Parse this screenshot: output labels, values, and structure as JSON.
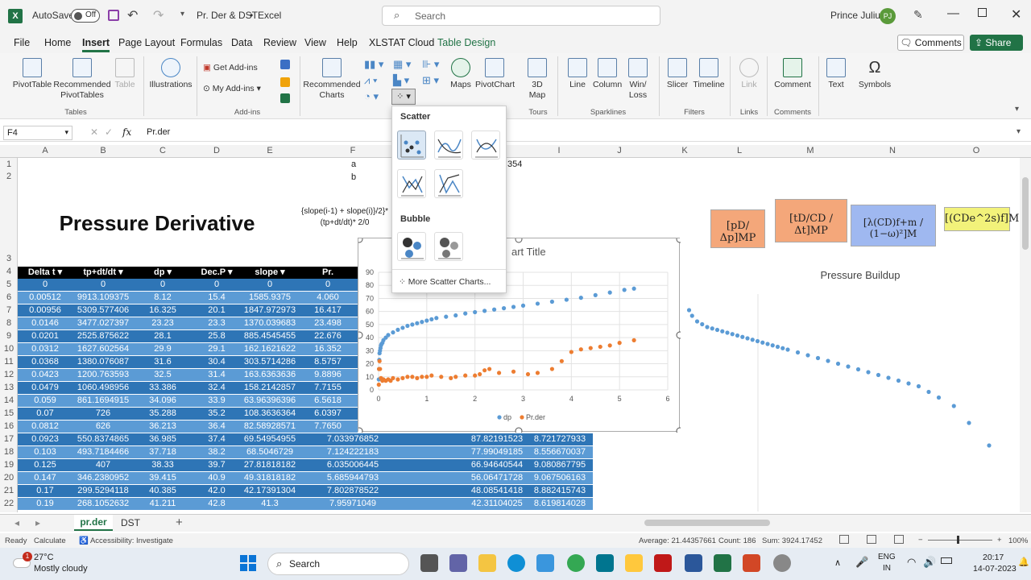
{
  "titlebar": {
    "autosave_label": "AutoSave",
    "autosave_state": "Off",
    "doc_title": "Pr. Der & DST",
    "sep": "•",
    "app_name": "Excel",
    "search_placeholder": "Search",
    "user_name": "Prince Julius",
    "user_initials": "PJ"
  },
  "menu": {
    "items": [
      "File",
      "Home",
      "Insert",
      "Page Layout",
      "Formulas",
      "Data",
      "Review",
      "View",
      "Help",
      "XLSTAT Cloud",
      "Table Design"
    ],
    "comments_label": "Comments",
    "share_label": "Share"
  },
  "ribbon": {
    "pivot": "PivotTable",
    "rec_pivot": "Recommended PivotTables",
    "table": "Table",
    "illustrations": "Illustrations",
    "get_addins": "Get Add-ins",
    "my_addins": "My Add-ins",
    "rec_charts": "Recommended Charts",
    "maps": "Maps",
    "pivotchart": "PivotChart",
    "map3d": "3D Map",
    "line": "Line",
    "column": "Column",
    "winloss": "Win/ Loss",
    "slicer": "Slicer",
    "timeline": "Timeline",
    "link": "Link",
    "comment": "Comment",
    "text": "Text",
    "symbols": "Symbols",
    "groups": [
      "Tables",
      "Add-ins",
      "Tours",
      "Sparklines",
      "Filters",
      "Links",
      "Comments"
    ]
  },
  "formula_bar": {
    "name_box": "F4",
    "fx": "fx",
    "content": "Pr.der"
  },
  "columns": [
    "A",
    "B",
    "C",
    "D",
    "E",
    "F",
    "G",
    "H",
    "I",
    "J",
    "K",
    "L",
    "M",
    "N",
    "O"
  ],
  "rows": [
    "1",
    "2",
    "3",
    "4",
    "5",
    "6",
    "7",
    "8",
    "9",
    "10",
    "11",
    "12",
    "13",
    "14",
    "15",
    "16",
    "17",
    "18",
    "19",
    "20",
    "21",
    "22"
  ],
  "sheet": {
    "row1_f": "a",
    "row2_f": "b",
    "h1_value": "354",
    "title": "Pressure Derivative",
    "formula_note": "{slope(i-1) + slope(i)}/2}*(tp+dt/dt)* 2/0",
    "headers": [
      "Delta t",
      "tp+dt/dt",
      "dp",
      "Dec.P",
      "slope",
      "Pr."
    ],
    "rows": [
      [
        "0",
        "0",
        "0",
        "0",
        "0",
        "0",
        "",
        ""
      ],
      [
        "0.00512",
        "9913.109375",
        "8.12",
        "15.4",
        "1585.9375",
        "4.060",
        "",
        ""
      ],
      [
        "0.00956",
        "5309.577406",
        "16.325",
        "20.1",
        "1847.972973",
        "16.417",
        "",
        ""
      ],
      [
        "0.0146",
        "3477.027397",
        "23.23",
        "23.3",
        "1370.039683",
        "23.498",
        "",
        ""
      ],
      [
        "0.0201",
        "2525.875622",
        "28.1",
        "25.8",
        "885.4545455",
        "22.676",
        "",
        ""
      ],
      [
        "0.0312",
        "1627.602564",
        "29.9",
        "29.1",
        "162.1621622",
        "16.352",
        "",
        ""
      ],
      [
        "0.0368",
        "1380.076087",
        "31.6",
        "30.4",
        "303.5714286",
        "8.5757",
        "",
        ""
      ],
      [
        "0.0423",
        "1200.763593",
        "32.5",
        "31.4",
        "163.6363636",
        "9.8896",
        "",
        ""
      ],
      [
        "0.0479",
        "1060.498956",
        "33.386",
        "32.4",
        "158.2142857",
        "7.7155",
        "",
        ""
      ],
      [
        "0.059",
        "861.1694915",
        "34.096",
        "33.9",
        "63.96396396",
        "6.5618",
        "",
        ""
      ],
      [
        "0.07",
        "726",
        "35.288",
        "35.2",
        "108.3636364",
        "6.0397",
        "",
        ""
      ],
      [
        "0.0812",
        "626",
        "36.213",
        "36.4",
        "82.58928571",
        "7.7650",
        "",
        ""
      ],
      [
        "0.0923",
        "550.8374865",
        "36.985",
        "37.4",
        "69.54954955",
        "7.033976852",
        "87.82191523",
        "8.721727933"
      ],
      [
        "0.103",
        "493.7184466",
        "37.718",
        "38.2",
        "68.5046729",
        "7.124222183",
        "77.99049185",
        "8.556670037"
      ],
      [
        "0.125",
        "407",
        "38.33",
        "39.7",
        "27.81818182",
        "6.035006445",
        "66.94640544",
        "9.080867795"
      ],
      [
        "0.147",
        "346.2380952",
        "39.415",
        "40.9",
        "49.31818182",
        "5.685944793",
        "56.06471728",
        "9.067506163"
      ],
      [
        "0.17",
        "299.5294118",
        "40.385",
        "42.0",
        "42.17391304",
        "7.802878522",
        "48.08541418",
        "8.882415743"
      ],
      [
        "0.19",
        "268.1052632",
        "41.211",
        "42.8",
        "41.3",
        "7.95971049",
        "42.31104025",
        "8.619814028"
      ]
    ]
  },
  "formulas": {
    "f1": "[pD/Δp]MP",
    "f2": "[tD/CD / Δt]MP",
    "f3": "[λ(CD)f+m / (1−ω)²]M",
    "f4": "[(CDe^2s)f]M"
  },
  "dropdown": {
    "scatter_label": "Scatter",
    "bubble_label": "Bubble",
    "more_label": "More Scatter Charts..."
  },
  "chart_data": [
    {
      "type": "scatter",
      "title": "Chart Title",
      "visible_title": "art Title",
      "x_ticks": [
        "0",
        "1",
        "2",
        "3",
        "4",
        "5",
        "6"
      ],
      "y_ticks": [
        "0",
        "10",
        "20",
        "30",
        "40",
        "50",
        "60",
        "70",
        "80",
        "90"
      ],
      "xlim": [
        0,
        6
      ],
      "ylim": [
        0,
        90
      ],
      "legend": "bottom",
      "grid": true,
      "series": [
        {
          "name": "dp",
          "color": "#5b9bd5",
          "points": [
            [
              0.005,
              8
            ],
            [
              0.01,
              16
            ],
            [
              0.015,
              23
            ],
            [
              0.02,
              28
            ],
            [
              0.03,
              30
            ],
            [
              0.04,
              32
            ],
            [
              0.05,
              34
            ],
            [
              0.06,
              35
            ],
            [
              0.08,
              36
            ],
            [
              0.1,
              38
            ],
            [
              0.15,
              40
            ],
            [
              0.2,
              42
            ],
            [
              0.3,
              44
            ],
            [
              0.4,
              46
            ],
            [
              0.5,
              47.5
            ],
            [
              0.6,
              49
            ],
            [
              0.7,
              50
            ],
            [
              0.8,
              51
            ],
            [
              0.9,
              52
            ],
            [
              1.0,
              53
            ],
            [
              1.1,
              54
            ],
            [
              1.2,
              55
            ],
            [
              1.4,
              56
            ],
            [
              1.6,
              57
            ],
            [
              1.8,
              58.5
            ],
            [
              2.0,
              59.5
            ],
            [
              2.2,
              60.5
            ],
            [
              2.4,
              61.5
            ],
            [
              2.6,
              62.5
            ],
            [
              2.8,
              63.5
            ],
            [
              3.0,
              64.5
            ],
            [
              3.3,
              66
            ],
            [
              3.6,
              67.5
            ],
            [
              3.9,
              69
            ],
            [
              4.2,
              70.5
            ],
            [
              4.5,
              72.5
            ],
            [
              4.8,
              74.5
            ],
            [
              5.1,
              76.5
            ],
            [
              5.3,
              77.5
            ]
          ]
        },
        {
          "name": "Pr.der",
          "color": "#ed7d31",
          "points": [
            [
              0.005,
              4
            ],
            [
              0.01,
              16
            ],
            [
              0.02,
              22
            ],
            [
              0.03,
              16
            ],
            [
              0.05,
              9
            ],
            [
              0.08,
              7
            ],
            [
              0.1,
              8
            ],
            [
              0.15,
              7
            ],
            [
              0.2,
              8
            ],
            [
              0.25,
              7
            ],
            [
              0.3,
              9
            ],
            [
              0.4,
              8
            ],
            [
              0.5,
              9
            ],
            [
              0.6,
              10
            ],
            [
              0.7,
              10
            ],
            [
              0.8,
              9
            ],
            [
              0.9,
              10
            ],
            [
              1.0,
              10
            ],
            [
              1.1,
              11
            ],
            [
              1.3,
              10
            ],
            [
              1.5,
              9
            ],
            [
              1.6,
              10
            ],
            [
              1.8,
              11
            ],
            [
              2.0,
              11
            ],
            [
              2.1,
              12
            ],
            [
              2.2,
              15
            ],
            [
              2.3,
              16
            ],
            [
              2.5,
              13
            ],
            [
              2.8,
              14
            ],
            [
              3.1,
              12
            ],
            [
              3.3,
              13
            ],
            [
              3.6,
              16
            ],
            [
              3.8,
              22
            ],
            [
              4.0,
              29
            ],
            [
              4.2,
              31
            ],
            [
              4.4,
              32
            ],
            [
              4.6,
              33
            ],
            [
              4.8,
              34
            ],
            [
              5.0,
              36
            ],
            [
              5.3,
              38
            ]
          ]
        }
      ]
    },
    {
      "type": "scatter",
      "title": "Pressure Buildup",
      "series": [
        {
          "name": "",
          "color": "#5b9bd5",
          "points": [
            [
              0.02,
              58
            ],
            [
              0.05,
              56
            ],
            [
              0.1,
              54
            ],
            [
              0.15,
              53
            ],
            [
              0.2,
              52
            ],
            [
              0.25,
              51.5
            ],
            [
              0.3,
              51
            ],
            [
              0.35,
              50.5
            ],
            [
              0.4,
              50
            ],
            [
              0.45,
              49.5
            ],
            [
              0.5,
              49
            ],
            [
              0.55,
              48.5
            ],
            [
              0.6,
              48
            ],
            [
              0.65,
              47.5
            ],
            [
              0.7,
              47
            ],
            [
              0.75,
              46.5
            ],
            [
              0.8,
              46
            ],
            [
              0.85,
              45.5
            ],
            [
              0.9,
              45
            ],
            [
              0.95,
              44.5
            ],
            [
              1.0,
              44
            ],
            [
              1.1,
              43
            ],
            [
              1.2,
              42
            ],
            [
              1.3,
              41
            ],
            [
              1.4,
              40
            ],
            [
              1.5,
              39
            ],
            [
              1.6,
              38
            ],
            [
              1.7,
              37
            ],
            [
              1.8,
              36
            ],
            [
              1.9,
              35
            ],
            [
              2.0,
              34
            ],
            [
              2.1,
              33
            ],
            [
              2.2,
              32
            ],
            [
              2.3,
              31
            ],
            [
              2.4,
              29
            ],
            [
              2.5,
              27
            ],
            [
              2.65,
              24
            ],
            [
              2.8,
              18
            ],
            [
              3.0,
              10
            ]
          ]
        }
      ]
    }
  ],
  "sheet_tabs": [
    "pr.der",
    "DST"
  ],
  "status": {
    "ready": "Ready",
    "calculate": "Calculate",
    "accessibility": "Accessibility: Investigate",
    "average": "Average: 21.44357661",
    "count": "Count: 186",
    "sum": "Sum: 3924.17452",
    "zoom": "100%"
  },
  "taskbar": {
    "temp": "27°C",
    "weather": "Mostly cloudy",
    "search": "Search",
    "lang1": "ENG",
    "lang2": "IN",
    "time": "20:17",
    "date": "14-07-2023",
    "badge": "1"
  }
}
